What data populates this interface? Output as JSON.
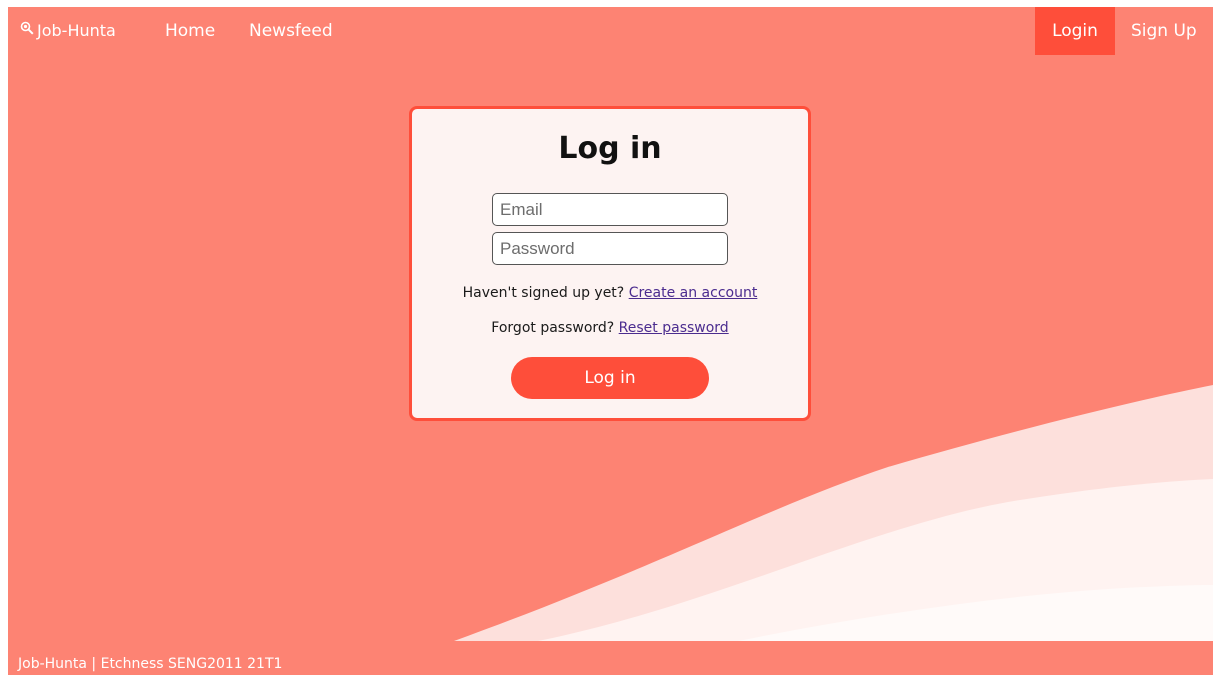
{
  "nav": {
    "brand": "Job-Hunta",
    "brand_icon": "magnifier-icon",
    "home": "Home",
    "newsfeed": "Newsfeed",
    "login": "Login",
    "signup": "Sign Up"
  },
  "login_card": {
    "title": "Log in",
    "email_placeholder": "Email",
    "password_placeholder": "Password",
    "signup_prompt": "Haven't signed up yet?",
    "signup_link": "Create an account",
    "reset_prompt": "Forgot password?",
    "reset_link": "Reset password",
    "submit_label": "Log in"
  },
  "footer": {
    "text": "Job-Hunta | Etchness SENG2011 21T1"
  },
  "colors": {
    "background": "#fd8373",
    "accent": "#fe4e3a",
    "card_background": "#fdf3f2",
    "wave_light": "#fde0dc",
    "wave_white": "#fffaf9",
    "link": "#4b2c8f"
  }
}
